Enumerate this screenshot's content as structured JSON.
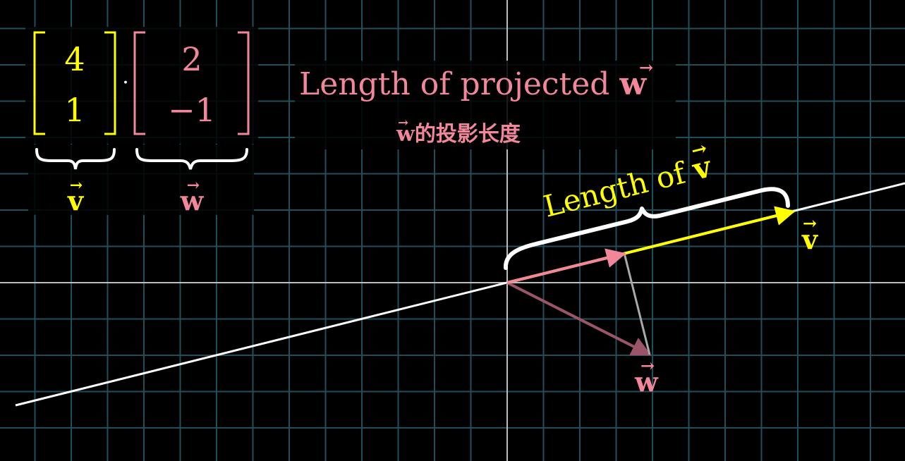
{
  "colors": {
    "background": "#000000",
    "grid": "#1f4f5a",
    "axis": "#bdbdbd",
    "line": "#ffffff",
    "v": "#ffff00",
    "w": "#f2879b",
    "w_vector": "#9a5568",
    "projection_connector": "#a9a9a9",
    "brace": "#ffffff"
  },
  "vector_v": {
    "label": "v",
    "components": [
      "4",
      "1"
    ]
  },
  "vector_w": {
    "label": "w",
    "components": [
      "2",
      "−1"
    ]
  },
  "dot_operator": "·",
  "caption": {
    "line1_text": "Length of projected ",
    "line1_symbol": "w",
    "line2_symbol": "w",
    "line2_text": "的投影长度"
  },
  "length_of_v": {
    "text": "Length of ",
    "symbol": "v"
  },
  "plot_labels": {
    "v": "v",
    "w": "w"
  },
  "arrow_mark": "→",
  "chart_data": {
    "type": "vector-diagram",
    "vectors": [
      {
        "name": "v",
        "x": 4,
        "y": 1
      },
      {
        "name": "w",
        "x": 2,
        "y": -1
      },
      {
        "name": "projection of w onto v",
        "x": 1.647,
        "y": 0.412
      }
    ],
    "grid": true
  }
}
